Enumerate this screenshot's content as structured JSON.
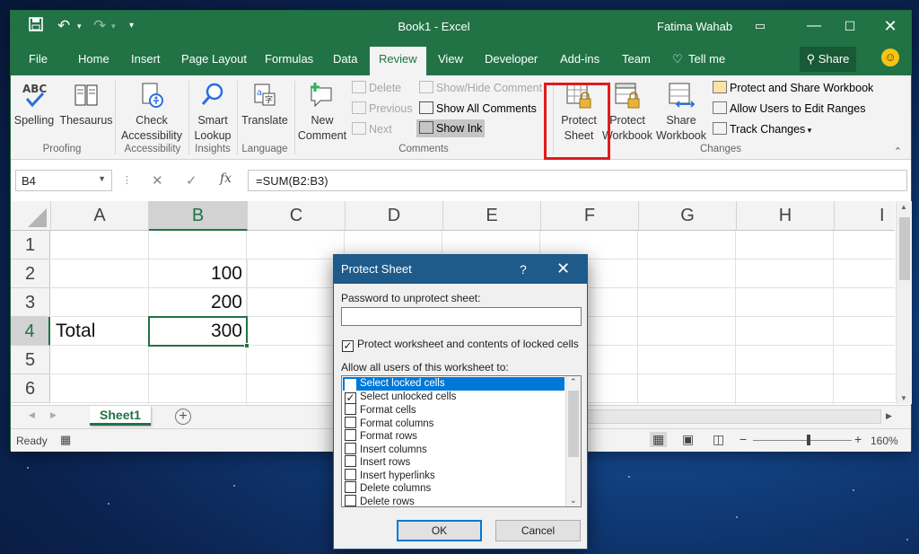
{
  "window": {
    "title": "Book1  -  Excel",
    "user": "Fatima Wahab"
  },
  "tabs": [
    {
      "label": "File"
    },
    {
      "label": "Home"
    },
    {
      "label": "Insert"
    },
    {
      "label": "Page Layout"
    },
    {
      "label": "Formulas"
    },
    {
      "label": "Data"
    },
    {
      "label": "Review"
    },
    {
      "label": "View"
    },
    {
      "label": "Developer"
    },
    {
      "label": "Add-ins"
    },
    {
      "label": "Team"
    },
    {
      "label": "Tell me"
    }
  ],
  "share_label": "Share",
  "ribbon": {
    "spelling": "Spelling",
    "thesaurus": "Thesaurus",
    "proofing": "Proofing",
    "check": "Check",
    "accessibility_btn": "Accessibility",
    "accessibility_group": "Accessibility",
    "smart": "Smart",
    "lookup": "Lookup",
    "insights": "Insights",
    "translate": "Translate",
    "language": "Language",
    "new": "New",
    "comment": "Comment",
    "delete": "Delete",
    "previous": "Previous",
    "next": "Next",
    "show_hide": "Show/Hide Comment",
    "show_all": "Show All Comments",
    "show_ink": "Show Ink",
    "comments_group": "Comments",
    "protect": "Protect",
    "sheet": "Sheet",
    "protect2": "Protect",
    "workbook": "Workbook",
    "share": "Share",
    "workbook2": "Workbook",
    "protect_share": "Protect and Share Workbook",
    "allow_users": "Allow Users to Edit Ranges",
    "track_changes": "Track Changes",
    "changes_group": "Changes"
  },
  "formula_bar": {
    "name_box": "B4",
    "formula": "=SUM(B2:B3)"
  },
  "sheet": {
    "columns": [
      "A",
      "B",
      "C",
      "D",
      "E",
      "F",
      "G",
      "H",
      "I"
    ],
    "rows": [
      "1",
      "2",
      "3",
      "4",
      "5",
      "6"
    ],
    "cells": {
      "B2": "100",
      "B3": "200",
      "A4": "Total",
      "B4": "300"
    },
    "tab": "Sheet1"
  },
  "status": {
    "ready": "Ready",
    "zoom": "160%"
  },
  "dialog": {
    "title": "Protect Sheet",
    "help": "?",
    "password_label": "Password to unprotect sheet:",
    "password_value": "",
    "protect_contents": "Protect worksheet and contents of locked cells",
    "allow_label": "Allow all users of this worksheet to:",
    "permissions": [
      {
        "label": "Select locked cells",
        "checked": true
      },
      {
        "label": "Select unlocked cells",
        "checked": true
      },
      {
        "label": "Format cells",
        "checked": false
      },
      {
        "label": "Format columns",
        "checked": false
      },
      {
        "label": "Format rows",
        "checked": false
      },
      {
        "label": "Insert columns",
        "checked": false
      },
      {
        "label": "Insert rows",
        "checked": false
      },
      {
        "label": "Insert hyperlinks",
        "checked": false
      },
      {
        "label": "Delete columns",
        "checked": false
      },
      {
        "label": "Delete rows",
        "checked": false
      }
    ],
    "ok": "OK",
    "cancel": "Cancel"
  },
  "colors": {
    "excel_green": "#217346",
    "highlight_red": "#e01b1b",
    "dialog_blue": "#1e5a8a"
  }
}
